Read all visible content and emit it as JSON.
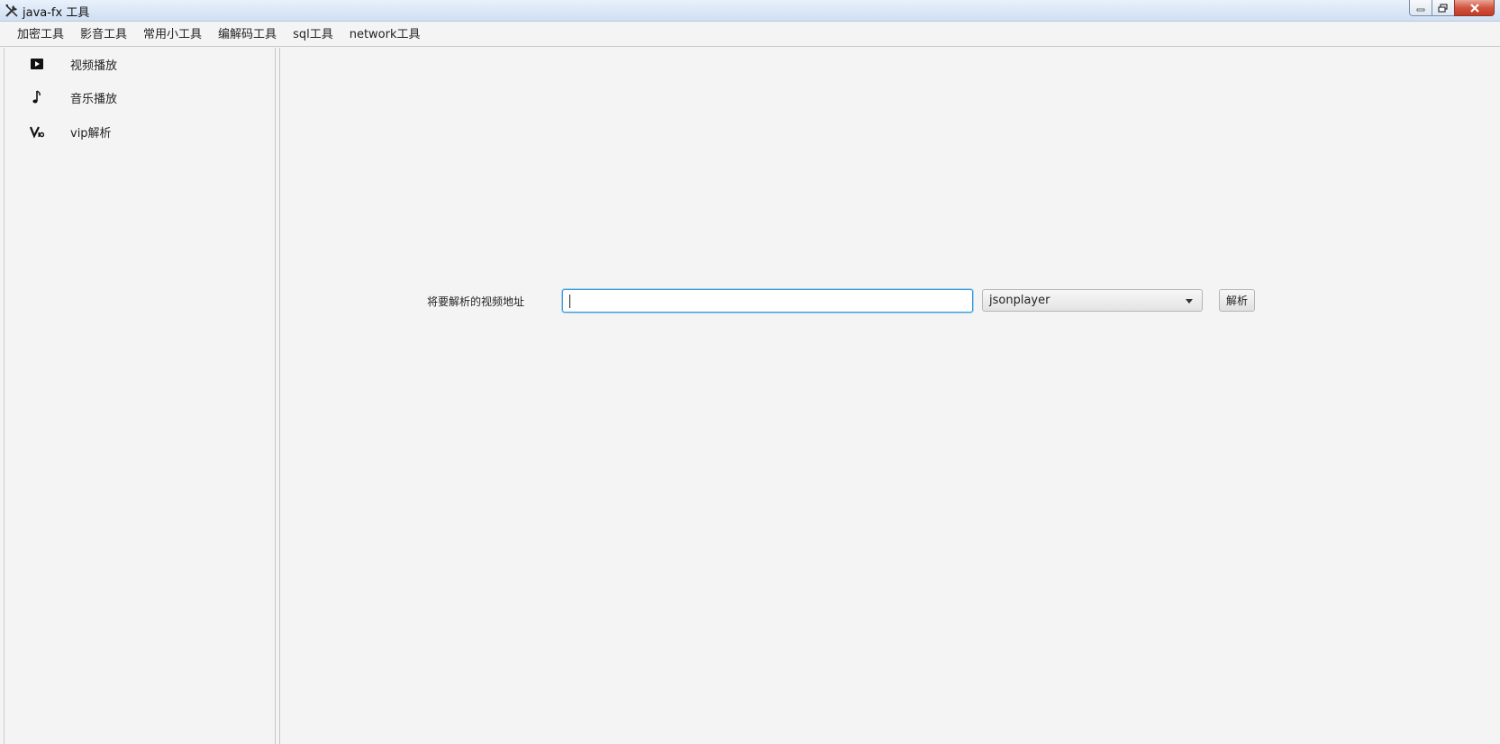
{
  "window": {
    "title": "java-fx 工具",
    "controls": [
      "minimize",
      "maximize",
      "close"
    ]
  },
  "menubar": {
    "items": [
      "加密工具",
      "影音工具",
      "常用小工具",
      "编解码工具",
      "sql工具",
      "network工具"
    ]
  },
  "sidebar": {
    "items": [
      {
        "label": "视频播放",
        "icon": "play-icon"
      },
      {
        "label": "音乐播放",
        "icon": "music-note-icon"
      },
      {
        "label": "vip解析",
        "icon": "vip-icon"
      }
    ]
  },
  "form": {
    "label": "将要解析的视频地址",
    "url_value": "",
    "url_placeholder": "",
    "parser_selected": "jsonplayer",
    "parse_button": "解析"
  },
  "colors": {
    "focus_border": "#3b99d6",
    "background": "#f4f4f4",
    "titlebar": "#d8e6f6",
    "close_button": "#c33a24"
  }
}
